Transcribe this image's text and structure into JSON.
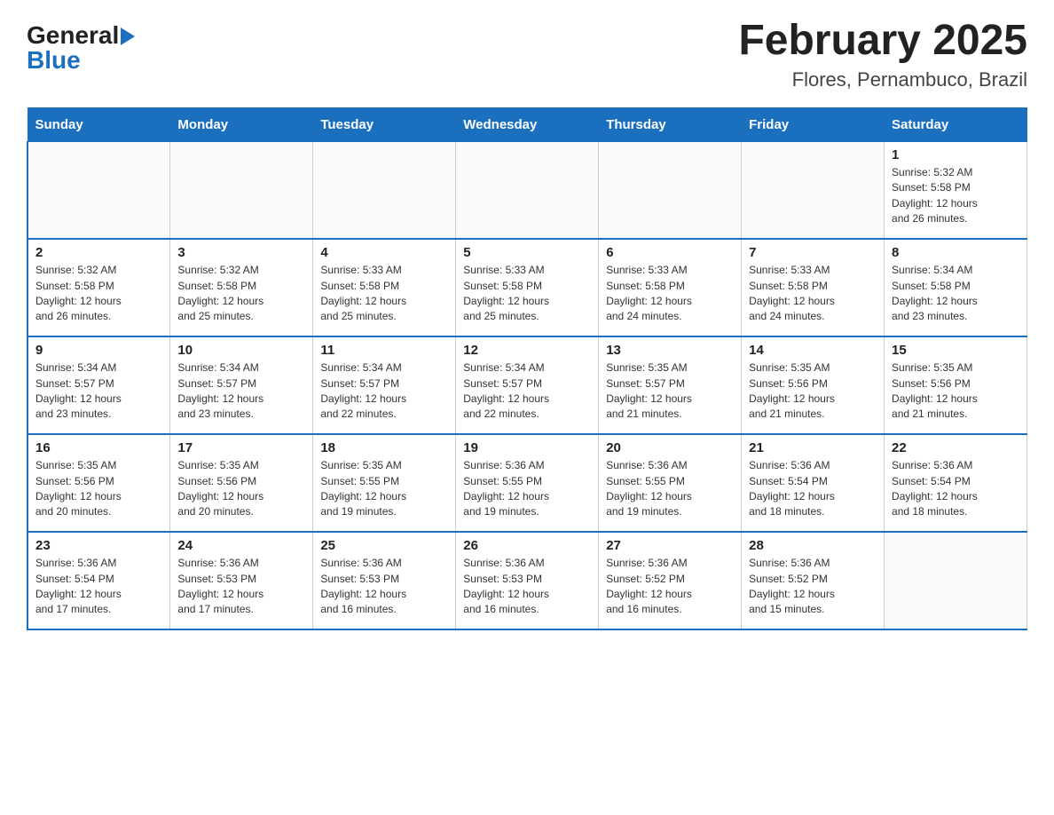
{
  "header": {
    "title": "February 2025",
    "subtitle": "Flores, Pernambuco, Brazil",
    "logo_general": "General",
    "logo_blue": "Blue"
  },
  "days_of_week": [
    "Sunday",
    "Monday",
    "Tuesday",
    "Wednesday",
    "Thursday",
    "Friday",
    "Saturday"
  ],
  "weeks": [
    [
      {
        "day": "",
        "info": ""
      },
      {
        "day": "",
        "info": ""
      },
      {
        "day": "",
        "info": ""
      },
      {
        "day": "",
        "info": ""
      },
      {
        "day": "",
        "info": ""
      },
      {
        "day": "",
        "info": ""
      },
      {
        "day": "1",
        "info": "Sunrise: 5:32 AM\nSunset: 5:58 PM\nDaylight: 12 hours\nand 26 minutes."
      }
    ],
    [
      {
        "day": "2",
        "info": "Sunrise: 5:32 AM\nSunset: 5:58 PM\nDaylight: 12 hours\nand 26 minutes."
      },
      {
        "day": "3",
        "info": "Sunrise: 5:32 AM\nSunset: 5:58 PM\nDaylight: 12 hours\nand 25 minutes."
      },
      {
        "day": "4",
        "info": "Sunrise: 5:33 AM\nSunset: 5:58 PM\nDaylight: 12 hours\nand 25 minutes."
      },
      {
        "day": "5",
        "info": "Sunrise: 5:33 AM\nSunset: 5:58 PM\nDaylight: 12 hours\nand 25 minutes."
      },
      {
        "day": "6",
        "info": "Sunrise: 5:33 AM\nSunset: 5:58 PM\nDaylight: 12 hours\nand 24 minutes."
      },
      {
        "day": "7",
        "info": "Sunrise: 5:33 AM\nSunset: 5:58 PM\nDaylight: 12 hours\nand 24 minutes."
      },
      {
        "day": "8",
        "info": "Sunrise: 5:34 AM\nSunset: 5:58 PM\nDaylight: 12 hours\nand 23 minutes."
      }
    ],
    [
      {
        "day": "9",
        "info": "Sunrise: 5:34 AM\nSunset: 5:57 PM\nDaylight: 12 hours\nand 23 minutes."
      },
      {
        "day": "10",
        "info": "Sunrise: 5:34 AM\nSunset: 5:57 PM\nDaylight: 12 hours\nand 23 minutes."
      },
      {
        "day": "11",
        "info": "Sunrise: 5:34 AM\nSunset: 5:57 PM\nDaylight: 12 hours\nand 22 minutes."
      },
      {
        "day": "12",
        "info": "Sunrise: 5:34 AM\nSunset: 5:57 PM\nDaylight: 12 hours\nand 22 minutes."
      },
      {
        "day": "13",
        "info": "Sunrise: 5:35 AM\nSunset: 5:57 PM\nDaylight: 12 hours\nand 21 minutes."
      },
      {
        "day": "14",
        "info": "Sunrise: 5:35 AM\nSunset: 5:56 PM\nDaylight: 12 hours\nand 21 minutes."
      },
      {
        "day": "15",
        "info": "Sunrise: 5:35 AM\nSunset: 5:56 PM\nDaylight: 12 hours\nand 21 minutes."
      }
    ],
    [
      {
        "day": "16",
        "info": "Sunrise: 5:35 AM\nSunset: 5:56 PM\nDaylight: 12 hours\nand 20 minutes."
      },
      {
        "day": "17",
        "info": "Sunrise: 5:35 AM\nSunset: 5:56 PM\nDaylight: 12 hours\nand 20 minutes."
      },
      {
        "day": "18",
        "info": "Sunrise: 5:35 AM\nSunset: 5:55 PM\nDaylight: 12 hours\nand 19 minutes."
      },
      {
        "day": "19",
        "info": "Sunrise: 5:36 AM\nSunset: 5:55 PM\nDaylight: 12 hours\nand 19 minutes."
      },
      {
        "day": "20",
        "info": "Sunrise: 5:36 AM\nSunset: 5:55 PM\nDaylight: 12 hours\nand 19 minutes."
      },
      {
        "day": "21",
        "info": "Sunrise: 5:36 AM\nSunset: 5:54 PM\nDaylight: 12 hours\nand 18 minutes."
      },
      {
        "day": "22",
        "info": "Sunrise: 5:36 AM\nSunset: 5:54 PM\nDaylight: 12 hours\nand 18 minutes."
      }
    ],
    [
      {
        "day": "23",
        "info": "Sunrise: 5:36 AM\nSunset: 5:54 PM\nDaylight: 12 hours\nand 17 minutes."
      },
      {
        "day": "24",
        "info": "Sunrise: 5:36 AM\nSunset: 5:53 PM\nDaylight: 12 hours\nand 17 minutes."
      },
      {
        "day": "25",
        "info": "Sunrise: 5:36 AM\nSunset: 5:53 PM\nDaylight: 12 hours\nand 16 minutes."
      },
      {
        "day": "26",
        "info": "Sunrise: 5:36 AM\nSunset: 5:53 PM\nDaylight: 12 hours\nand 16 minutes."
      },
      {
        "day": "27",
        "info": "Sunrise: 5:36 AM\nSunset: 5:52 PM\nDaylight: 12 hours\nand 16 minutes."
      },
      {
        "day": "28",
        "info": "Sunrise: 5:36 AM\nSunset: 5:52 PM\nDaylight: 12 hours\nand 15 minutes."
      },
      {
        "day": "",
        "info": ""
      }
    ]
  ]
}
